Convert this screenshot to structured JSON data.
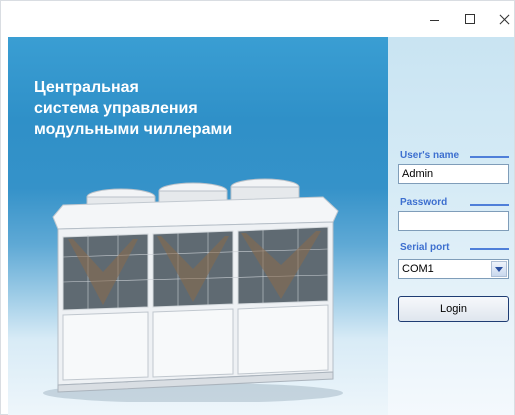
{
  "hero": {
    "title_lines": [
      "Центральная",
      "система управления",
      "модульными чиллерами"
    ]
  },
  "login": {
    "username_label": "User's name",
    "username_value": "Admin",
    "password_label": "Password",
    "password_value": "",
    "port_label": "Serial port",
    "port_value": "COM1",
    "login_button": "Login"
  },
  "window_controls": [
    "minimize-icon",
    "maximize-icon",
    "close-icon"
  ],
  "colors": {
    "label_blue": "#3d6fcf",
    "hero_blue": "#3592c9"
  }
}
